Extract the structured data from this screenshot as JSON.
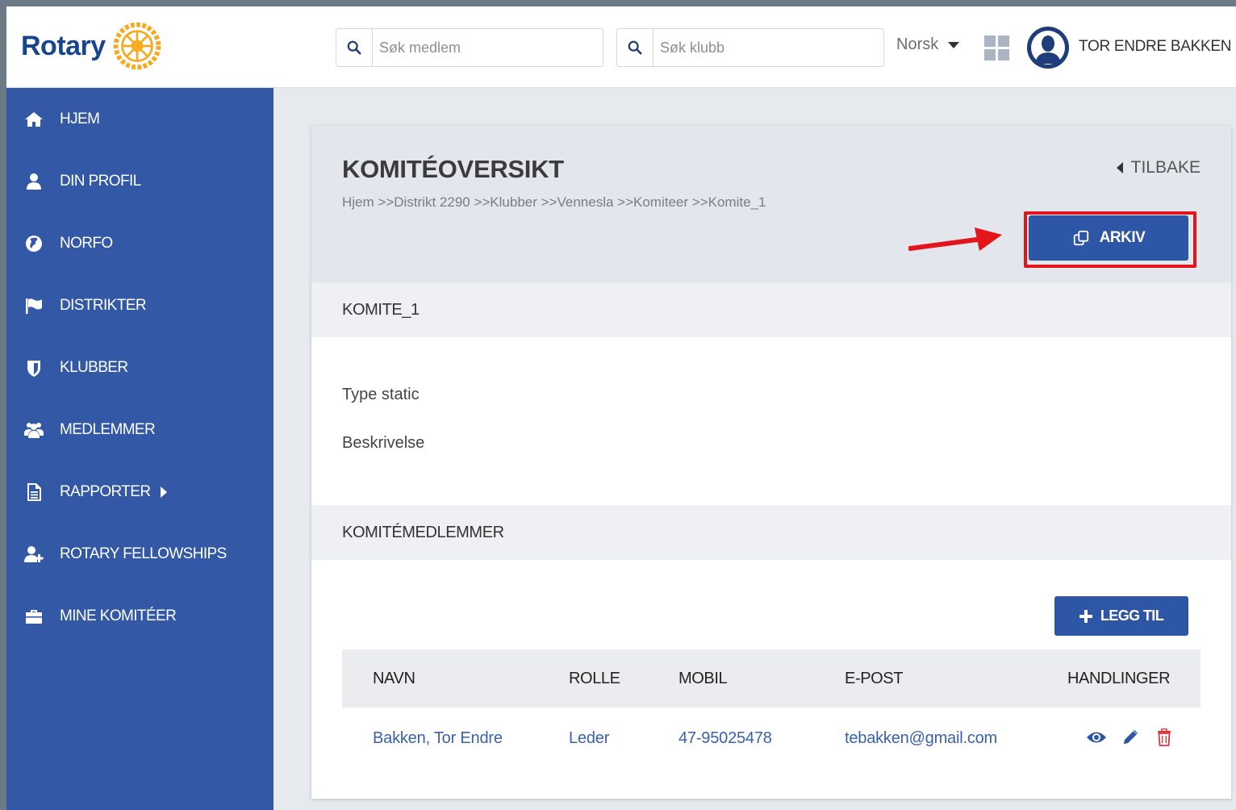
{
  "header": {
    "logo_text": "Rotary",
    "search_member_placeholder": "Søk medlem",
    "search_club_placeholder": "Søk klubb",
    "language": "Norsk",
    "user_name": "TOR ENDRE BAKKEN"
  },
  "sidebar": {
    "items": [
      {
        "label": "HJEM",
        "icon": "home-icon"
      },
      {
        "label": "DIN PROFIL",
        "icon": "user-icon"
      },
      {
        "label": "NORFO",
        "icon": "globe-icon"
      },
      {
        "label": "DISTRIKTER",
        "icon": "flag-icon"
      },
      {
        "label": "KLUBBER",
        "icon": "shield-icon"
      },
      {
        "label": "MEDLEMMER",
        "icon": "users-icon"
      },
      {
        "label": "RAPPORTER",
        "icon": "document-icon"
      },
      {
        "label": "ROTARY FELLOWSHIPS",
        "icon": "user-plus-icon"
      },
      {
        "label": "MINE KOMITÉER",
        "icon": "briefcase-icon"
      }
    ]
  },
  "page": {
    "title": "KOMITÉOVERSIKT",
    "breadcrumb": "Hjem >>Distrikt 2290 >>Klubber >>Vennesla >>Komiteer >>Komite_1",
    "back_label": "TILBAKE",
    "archive_label": "ARKIV",
    "committee_name": "KOMITE_1",
    "type_label": "Type static",
    "description_label": "Beskrivelse",
    "members_heading": "KOMITÉMEDLEMMER",
    "add_label": "LEGG TIL"
  },
  "table": {
    "columns": [
      "NAVN",
      "ROLLE",
      "MOBIL",
      "E-POST",
      "HANDLINGER"
    ],
    "rows": [
      {
        "name": "Bakken, Tor Endre",
        "role": "Leder",
        "mobile": "47-95025478",
        "email": "tebakken@gmail.com"
      }
    ]
  },
  "colors": {
    "sidebar": "#3258a6",
    "primary_button": "#2e56a6",
    "highlight": "#e3151b",
    "link": "#3a62aa",
    "logo": "#17458f",
    "logo_gold": "#f7a81b"
  }
}
